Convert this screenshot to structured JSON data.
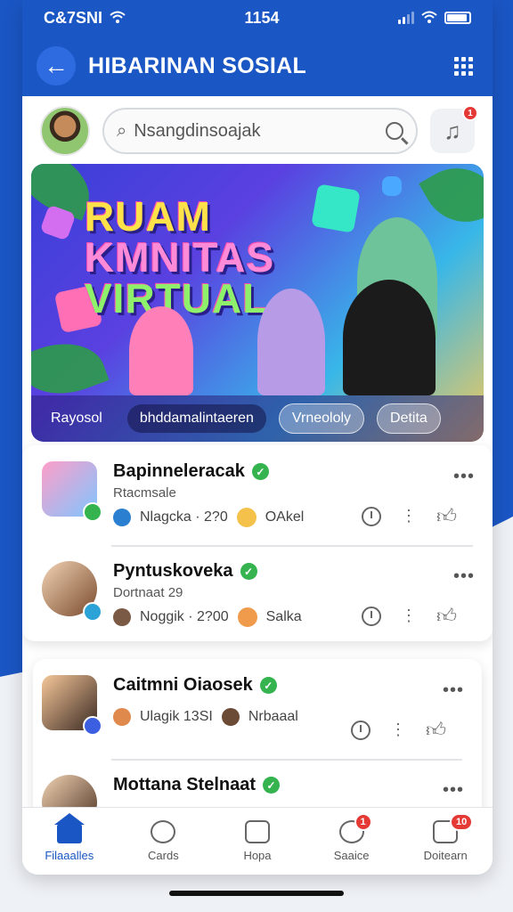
{
  "status_bar": {
    "carrier": "C&7SNI",
    "time": "1154"
  },
  "header": {
    "title": "HIBARINAN SOSIAL"
  },
  "search": {
    "placeholder": "Nsangdinsoajak",
    "music_badge": "1"
  },
  "banner": {
    "title_lines": [
      "RUAM",
      "KMNITAS",
      "VIRTUAL"
    ],
    "chips": [
      "Rayosol",
      "bhddamalintaeren",
      "Vrneololy",
      "Detita"
    ]
  },
  "posts": [
    {
      "name": "Bapinneleracak",
      "subtitle": "Rtacmsale",
      "meta_left": "Nlagcka · 2?0",
      "meta_right": "OAkel"
    },
    {
      "name": "Pyntuskoveka",
      "subtitle": "Dortnaat 29",
      "meta_left": "Noggik · 2?00",
      "meta_right": "Salka"
    },
    {
      "name": "Caitmni Oiaosek",
      "subtitle": "",
      "meta_left": "Ulagik 13SI",
      "meta_right": "Nrbaaal"
    },
    {
      "name": "Mottana Stelnaat",
      "subtitle": "",
      "meta_left": "",
      "meta_right": ""
    }
  ],
  "nav": {
    "items": [
      "Filaaalles",
      "Cards",
      "Hopa",
      "Saaice",
      "Doitearn"
    ],
    "badges": {
      "saaice": "1",
      "doitearn": "10"
    }
  },
  "colors": {
    "brand_blue": "#1a56c4",
    "verified_green": "#34b34f",
    "badge_red": "#e53935"
  }
}
